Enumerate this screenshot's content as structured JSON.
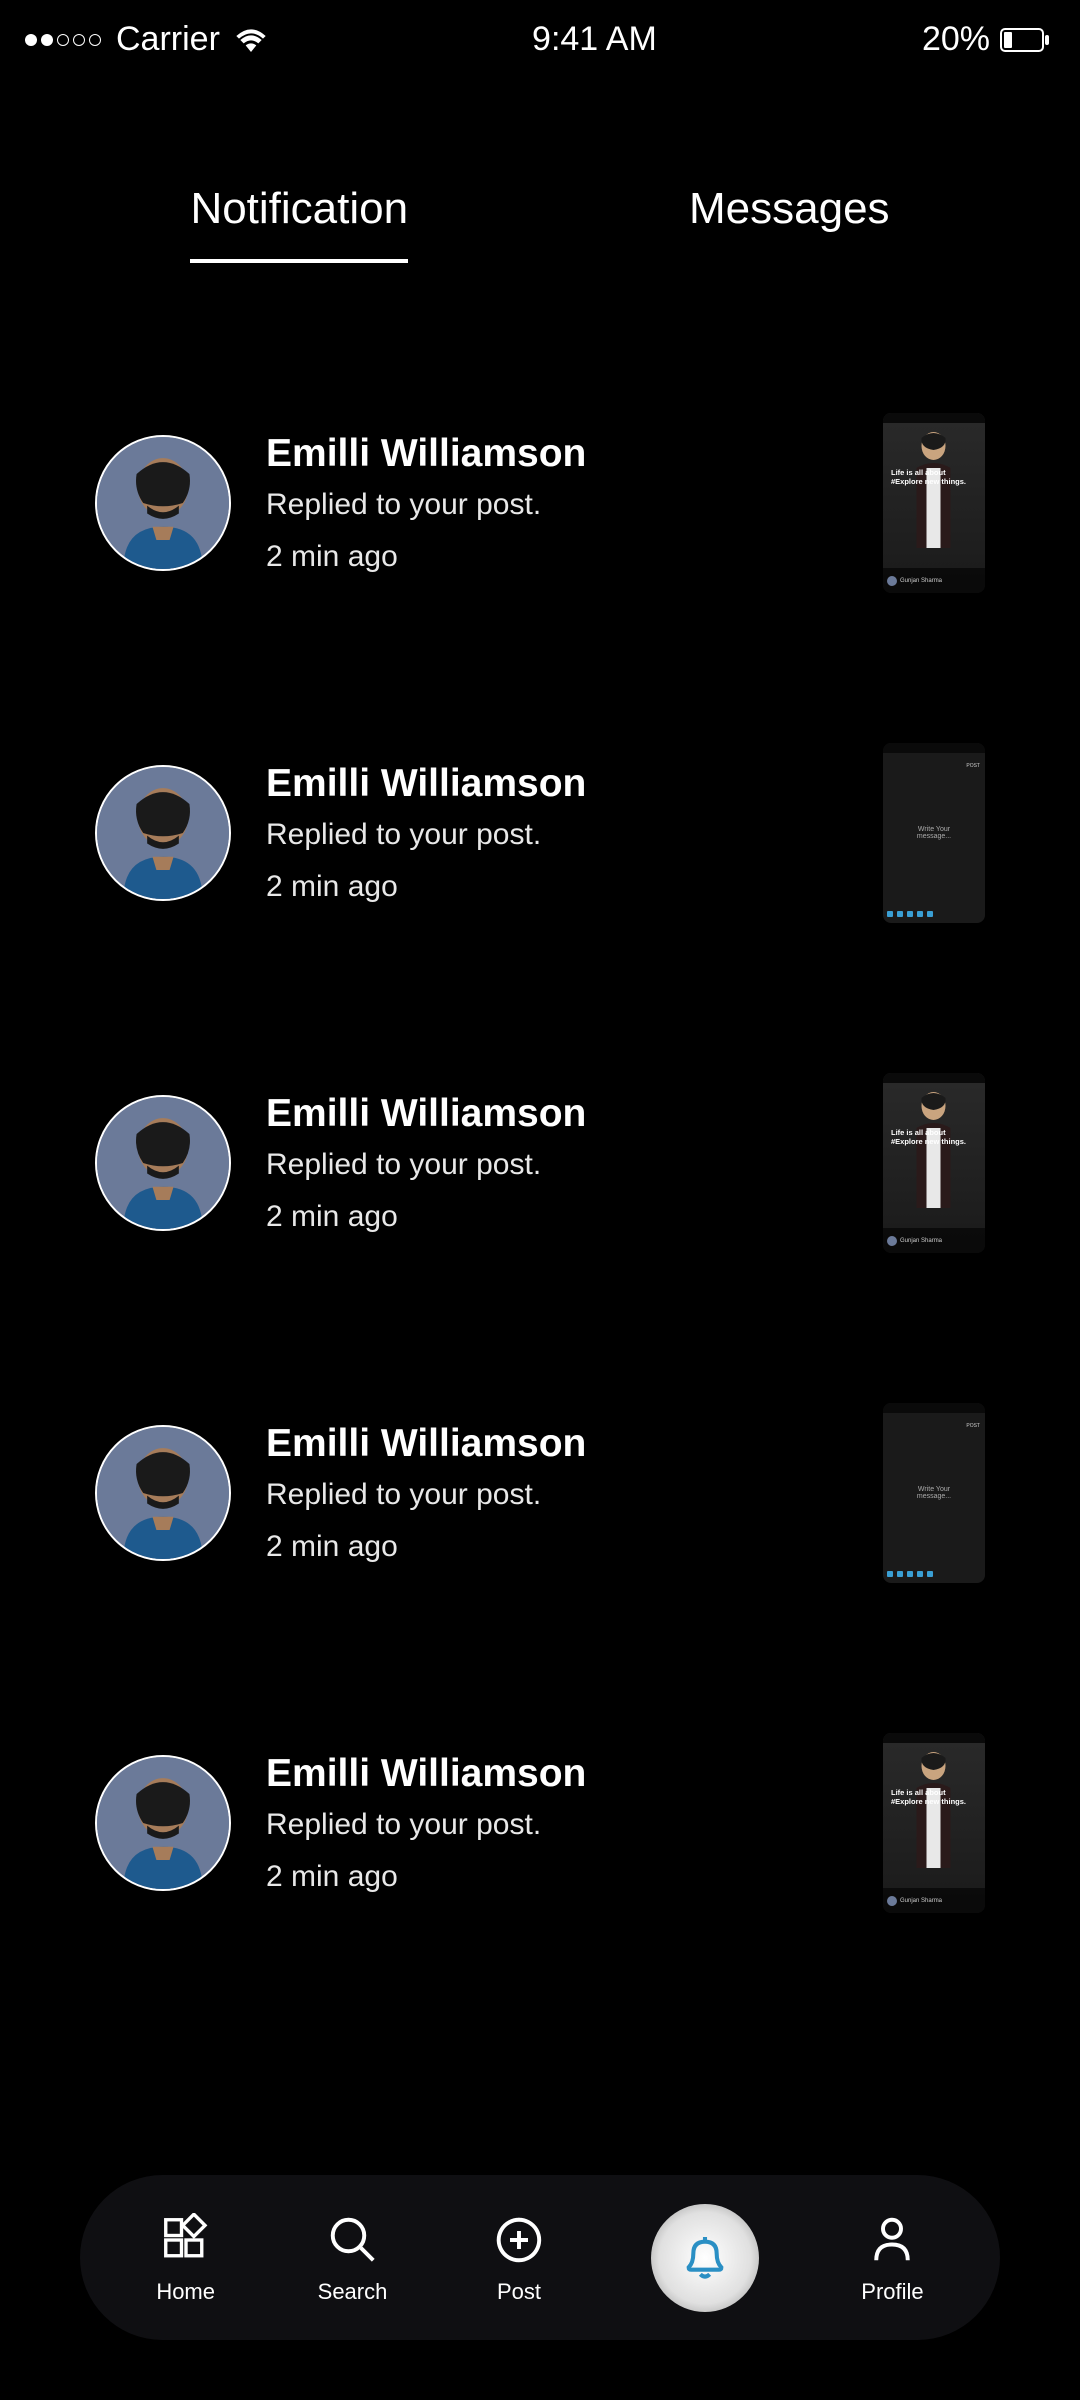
{
  "status_bar": {
    "carrier": "Carrier",
    "time": "9:41 AM",
    "battery_percent": "20%"
  },
  "tabs": {
    "notification": "Notification",
    "messages": "Messages"
  },
  "notifications": [
    {
      "name": "Emilli Williamson",
      "action": "Replied to your post.",
      "time": "2 min ago",
      "thumb_type": "story",
      "thumb_text": "Life is all about #Explore new things.",
      "thumb_author": "Gunjan Sharma"
    },
    {
      "name": "Emilli Williamson",
      "action": "Replied to your post.",
      "time": "2 min ago",
      "thumb_type": "message",
      "thumb_text": "Write Your message...",
      "thumb_post_label": "POST"
    },
    {
      "name": "Emilli Williamson",
      "action": "Replied to your post.",
      "time": "2 min ago",
      "thumb_type": "story",
      "thumb_text": "Life is all about #Explore new things.",
      "thumb_author": "Gunjan Sharma"
    },
    {
      "name": "Emilli Williamson",
      "action": "Replied to your post.",
      "time": "2 min ago",
      "thumb_type": "message",
      "thumb_text": "Write Your message...",
      "thumb_post_label": "POST"
    },
    {
      "name": "Emilli Williamson",
      "action": "Replied to your post.",
      "time": "2 min ago",
      "thumb_type": "story",
      "thumb_text": "Life is all about #Explore new things.",
      "thumb_author": "Gunjan Sharma"
    }
  ],
  "nav": {
    "home": "Home",
    "search": "Search",
    "post": "Post",
    "profile": "Profile"
  }
}
